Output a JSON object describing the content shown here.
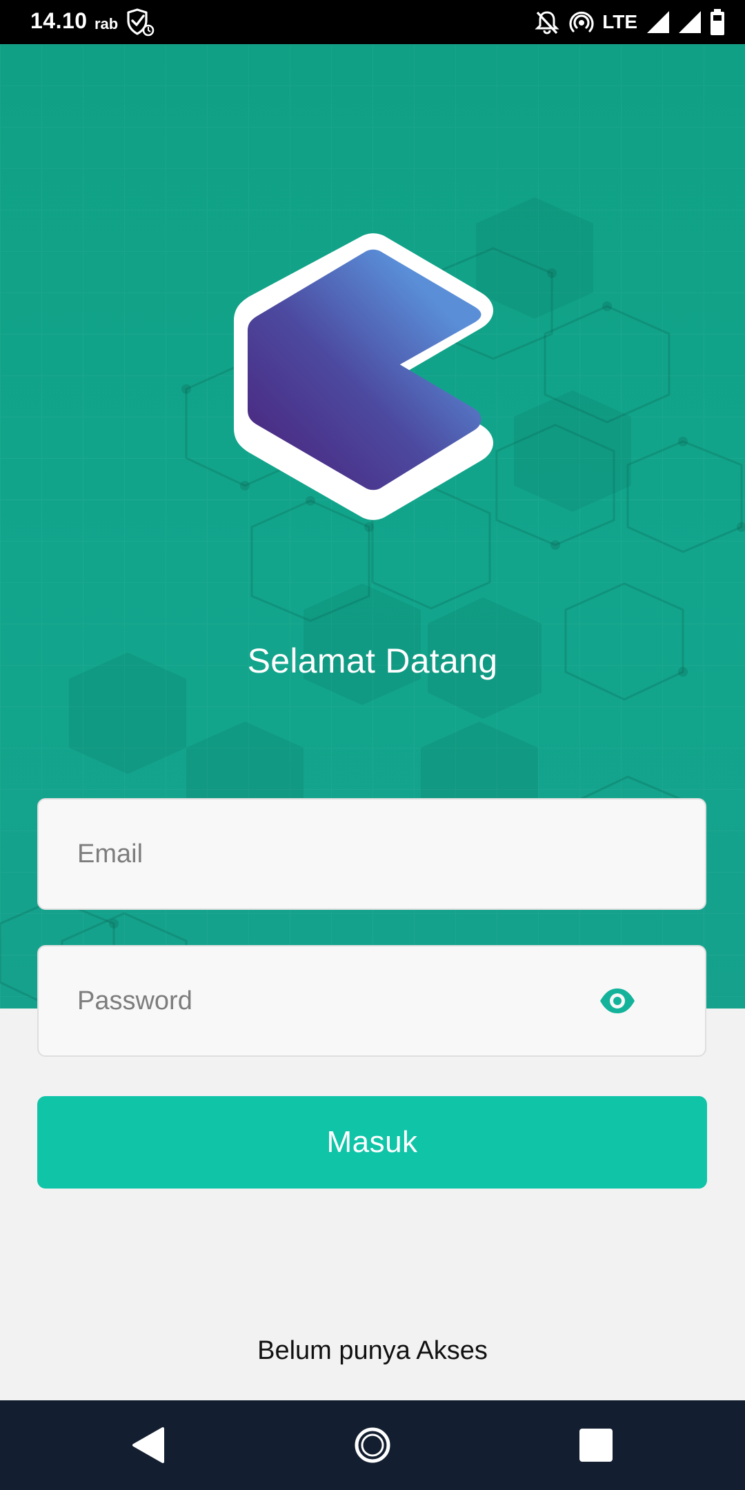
{
  "status_bar": {
    "time": "14.10",
    "day": "rab",
    "network": "LTE"
  },
  "icons": {
    "shield": "shield-check-icon",
    "notifications_off": "bell-off-icon",
    "hotspot": "hotspot-icon",
    "signal": "signal-icon",
    "battery": "battery-icon",
    "eye": "eye-icon",
    "logo": "app-logo-hexagon"
  },
  "login": {
    "welcome_text": "Selamat Datang",
    "email_placeholder": "Email",
    "email_value": "",
    "password_placeholder": "Password",
    "password_value": "",
    "submit_label": "Masuk",
    "register_link": "Belum punya Akses"
  },
  "colors": {
    "hero_background": "#12a58c",
    "accent": "#10c4a8",
    "eye_icon": "#12b39a",
    "logo_gradient_start": "#4a1f78",
    "logo_gradient_end": "#5a8fd8",
    "nav_bar": "#131f30"
  }
}
